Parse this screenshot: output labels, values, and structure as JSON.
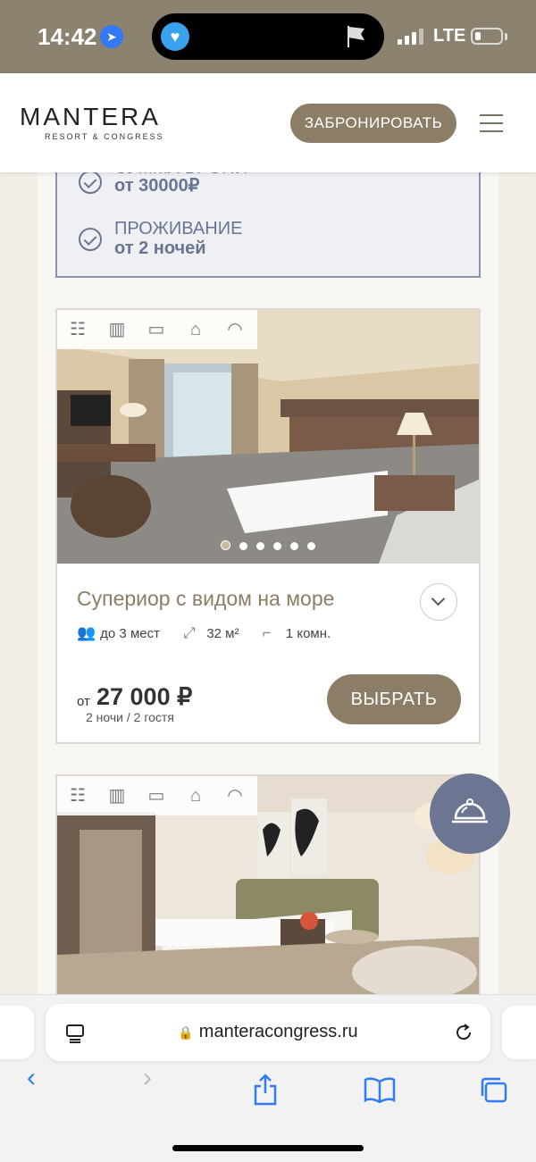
{
  "status": {
    "time": "14:42",
    "network": "LTE"
  },
  "header": {
    "logo": "MANTERA",
    "logo_sub": "RESORT & CONGRESS",
    "book_label": "ЗАБРОНИРОВАТЬ"
  },
  "features": [
    {
      "title": "СУММА БРОНИ",
      "value": "от 30000₽"
    },
    {
      "title": "ПРОЖИВАНИЕ",
      "value": "от 2 ночей"
    }
  ],
  "amenity_icons": [
    "sea-view-icon",
    "balcony-icon",
    "tv-icon",
    "wardrobe-icon",
    "wifi-icon"
  ],
  "rooms": [
    {
      "title": "Супериор с видом на море",
      "capacity": "до 3 мест",
      "area": "32 м²",
      "rooms_count": "1 комн.",
      "price_prefix": "от",
      "price": "27 000 ₽",
      "price_note": "2 ночи / 2 гостя",
      "select_label": "ВЫБРАТЬ",
      "photo_count": 6,
      "active_photo": 1
    }
  ],
  "browser": {
    "url": "manteracongress.ru"
  },
  "colors": {
    "accent": "#8b7d66",
    "feature": "#6a7592",
    "bell": "#6c7592",
    "ios_blue": "#2f7cf6"
  }
}
